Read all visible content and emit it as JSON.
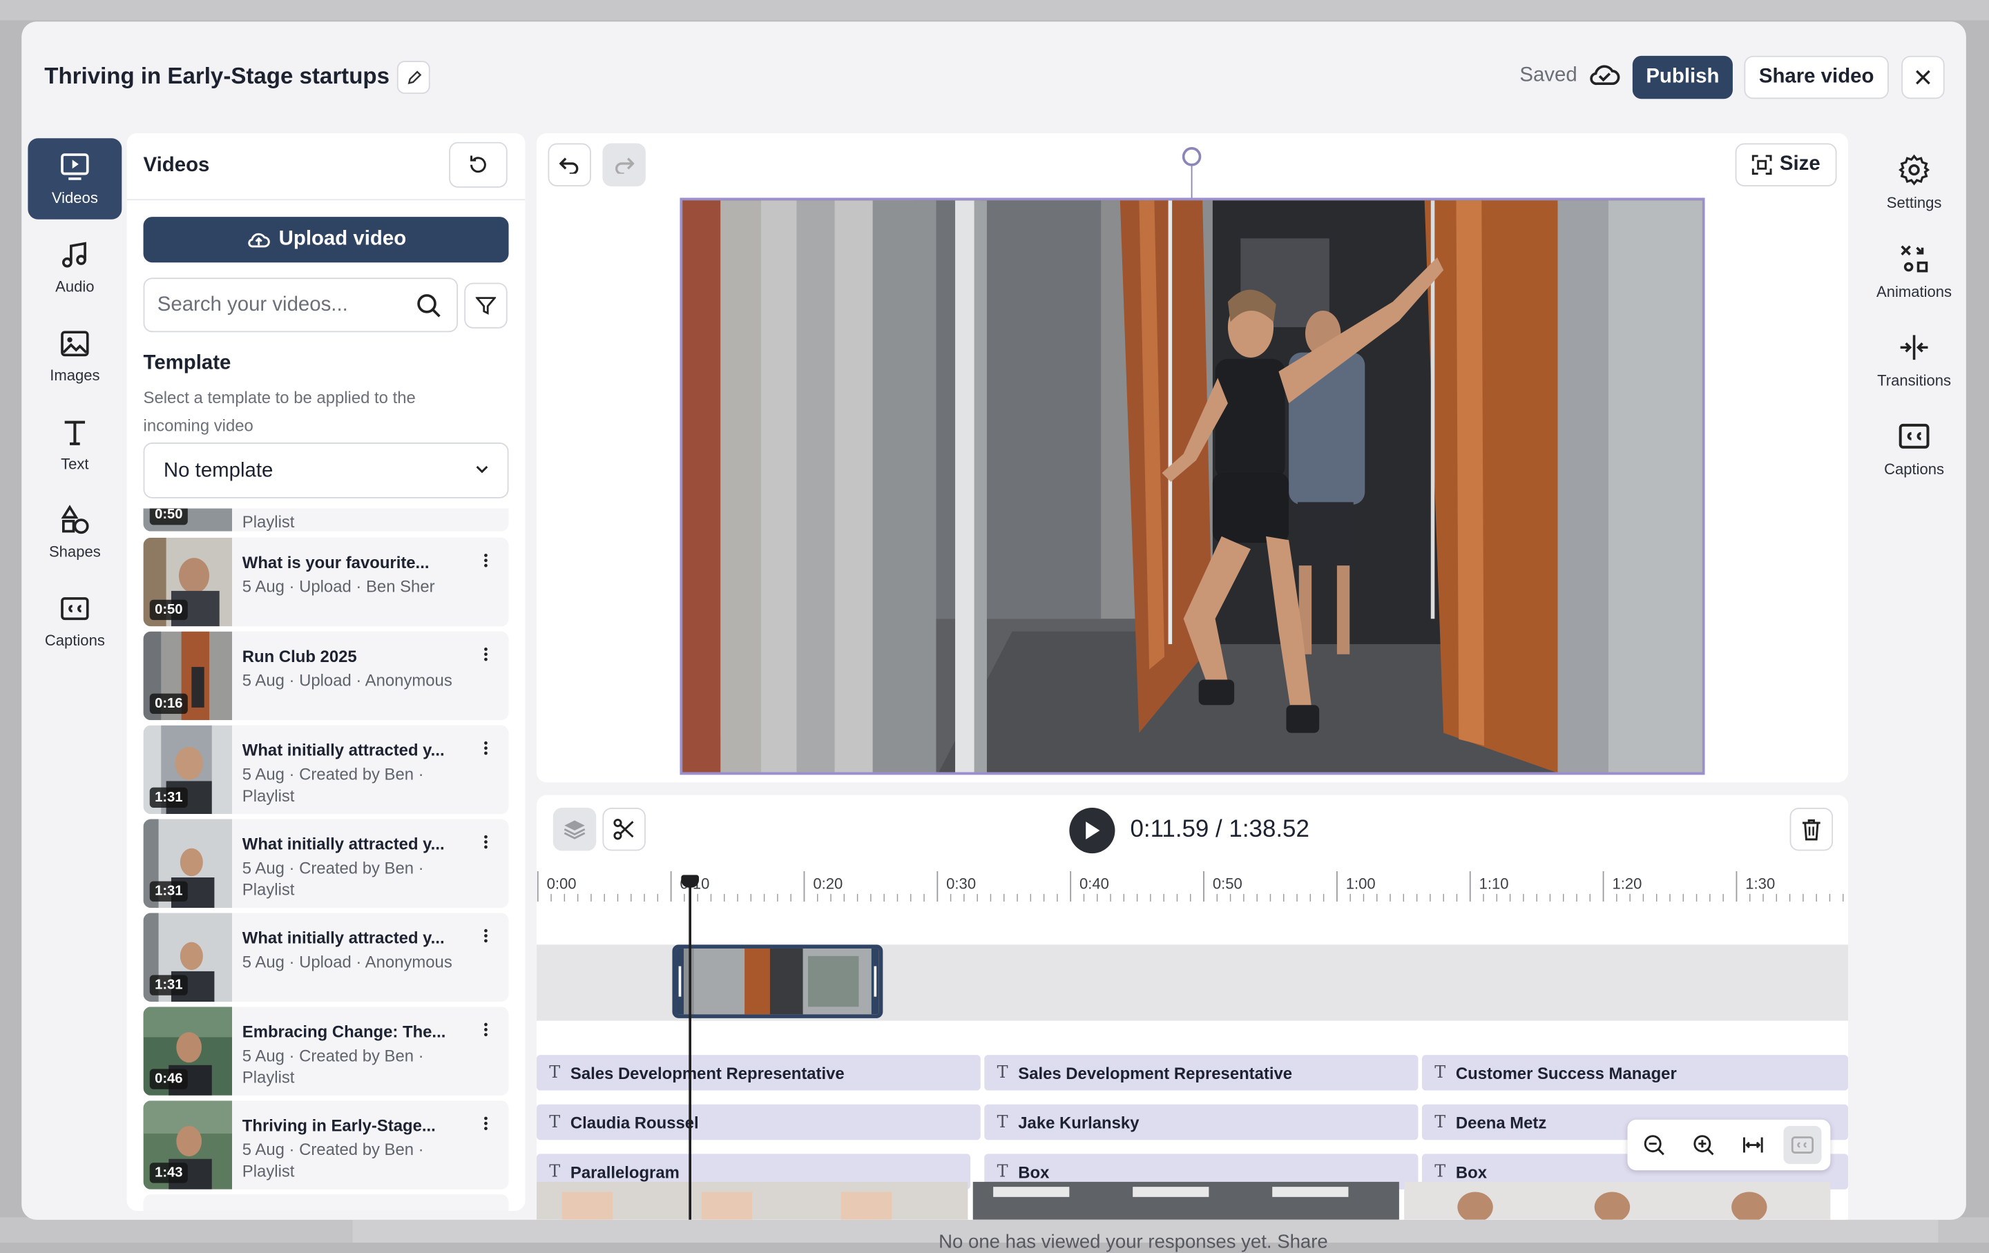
{
  "backdrop": {
    "note": "No one has viewed your responses yet. Share"
  },
  "header": {
    "title": "Thriving in Early-Stage startups",
    "saved": "Saved",
    "publish": "Publish",
    "share": "Share video"
  },
  "rail": [
    {
      "label": "Videos",
      "icon": "video-icon"
    },
    {
      "label": "Audio",
      "icon": "music-icon"
    },
    {
      "label": "Images",
      "icon": "image-icon"
    },
    {
      "label": "Text",
      "icon": "text-icon"
    },
    {
      "label": "Shapes",
      "icon": "shapes-icon"
    },
    {
      "label": "Captions",
      "icon": "captions-icon"
    }
  ],
  "panel": {
    "title": "Videos",
    "upload": "Upload video",
    "search_placeholder": "Search your videos...",
    "template_title": "Template",
    "template_desc": "Select a template to be applied to the incoming video",
    "template_value": "No template"
  },
  "videos": [
    {
      "title": "",
      "meta": "Playlist",
      "duration": "0:50"
    },
    {
      "title": "What is your favourite...",
      "meta": "5 Aug · Upload · Ben Sher",
      "duration": "0:50"
    },
    {
      "title": "Run Club 2025",
      "meta": "5 Aug · Upload · Anonymous",
      "duration": "0:16"
    },
    {
      "title": "What initially attracted y...",
      "meta": "5 Aug · Created by Ben · Playlist",
      "duration": "1:31"
    },
    {
      "title": "What initially attracted y...",
      "meta": "5 Aug · Created by Ben · Playlist",
      "duration": "1:31"
    },
    {
      "title": "What initially attracted y...",
      "meta": "5 Aug · Upload · Anonymous",
      "duration": "1:31"
    },
    {
      "title": "Embracing Change: The...",
      "meta": "5 Aug · Created by Ben · Playlist",
      "duration": "0:46"
    },
    {
      "title": "Thriving in Early-Stage...",
      "meta": "5 Aug · Created by Ben · Playlist",
      "duration": "1:43"
    }
  ],
  "canvas": {
    "size_label": "Size"
  },
  "timeline": {
    "time": "0:11.59 / 1:38.52",
    "ticks": [
      "0:00",
      "0:10",
      "0:20",
      "0:30",
      "0:40",
      "0:50",
      "1:00",
      "1:10",
      "1:20",
      "1:30"
    ],
    "rows": [
      [
        "Sales Development Representative",
        "Sales Development Representative",
        "Customer Success Manager"
      ],
      [
        "Claudia Roussel",
        "Jake Kurlansky",
        "Deena Metz"
      ],
      [
        "Parallelogram",
        "Box",
        "Box"
      ]
    ]
  },
  "right_rail": [
    {
      "label": "Settings",
      "icon": "gear-icon"
    },
    {
      "label": "Animations",
      "icon": "animations-icon"
    },
    {
      "label": "Transitions",
      "icon": "transitions-icon"
    },
    {
      "label": "Captions",
      "icon": "captions-icon"
    }
  ]
}
